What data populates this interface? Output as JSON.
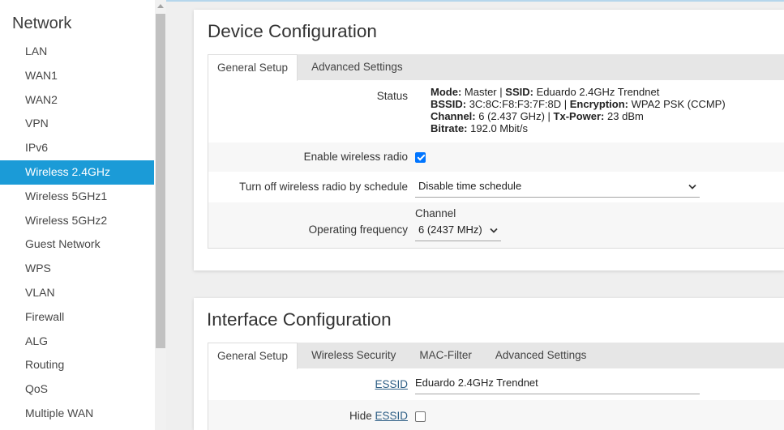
{
  "colors": {
    "accent": "#1b9bd7",
    "checkbox": "#0075ff",
    "link": "#2e5f86"
  },
  "sidebar": {
    "heading": "Network",
    "items": [
      {
        "label": "LAN"
      },
      {
        "label": "WAN1"
      },
      {
        "label": "WAN2"
      },
      {
        "label": "VPN"
      },
      {
        "label": "IPv6"
      },
      {
        "label": "Wireless 2.4GHz",
        "active": true
      },
      {
        "label": "Wireless 5GHz1"
      },
      {
        "label": "Wireless 5GHz2"
      },
      {
        "label": "Guest Network"
      },
      {
        "label": "WPS"
      },
      {
        "label": "VLAN"
      },
      {
        "label": "Firewall"
      },
      {
        "label": "ALG"
      },
      {
        "label": "Routing"
      },
      {
        "label": "QoS"
      },
      {
        "label": "Multiple WAN"
      }
    ]
  },
  "device_config": {
    "title": "Device Configuration",
    "tabs": [
      {
        "label": "General Setup",
        "active": true
      },
      {
        "label": "Advanced Settings"
      }
    ],
    "status": {
      "label": "Status",
      "separator": "|",
      "lines": [
        [
          {
            "key": "Mode:",
            "value": "Master"
          },
          {
            "key": "SSID:",
            "value": "Eduardo 2.4GHz Trendnet"
          }
        ],
        [
          {
            "key": "BSSID:",
            "value": "3C:8C:F8:F3:7F:8D"
          },
          {
            "key": "Encryption:",
            "value": "WPA2 PSK (CCMP)"
          }
        ],
        [
          {
            "key": "Channel:",
            "value": "6 (2.437 GHz)"
          },
          {
            "key": "Tx-Power:",
            "value": "23 dBm"
          }
        ],
        [
          {
            "key": "Bitrate:",
            "value": "192.0 Mbit/s"
          }
        ]
      ]
    },
    "enable_radio": {
      "label": "Enable wireless radio",
      "checked": true
    },
    "schedule": {
      "label": "Turn off wireless radio by schedule",
      "value": "Disable time schedule",
      "dropdown_icon": "chevron-down-icon"
    },
    "frequency": {
      "label": "Operating frequency",
      "channel_label": "Channel",
      "value": "6 (2437 MHz)",
      "dropdown_icon": "chevron-down-icon"
    }
  },
  "interface_config": {
    "title": "Interface Configuration",
    "tabs": [
      {
        "label": "General Setup",
        "active": true
      },
      {
        "label": "Wireless Security"
      },
      {
        "label": "MAC-Filter"
      },
      {
        "label": "Advanced Settings"
      }
    ],
    "essid": {
      "label": "ESSID",
      "value": "Eduardo 2.4GHz Trendnet"
    },
    "hide_essid": {
      "label_prefix": "Hide",
      "label_link": "ESSID",
      "checked": false
    }
  }
}
